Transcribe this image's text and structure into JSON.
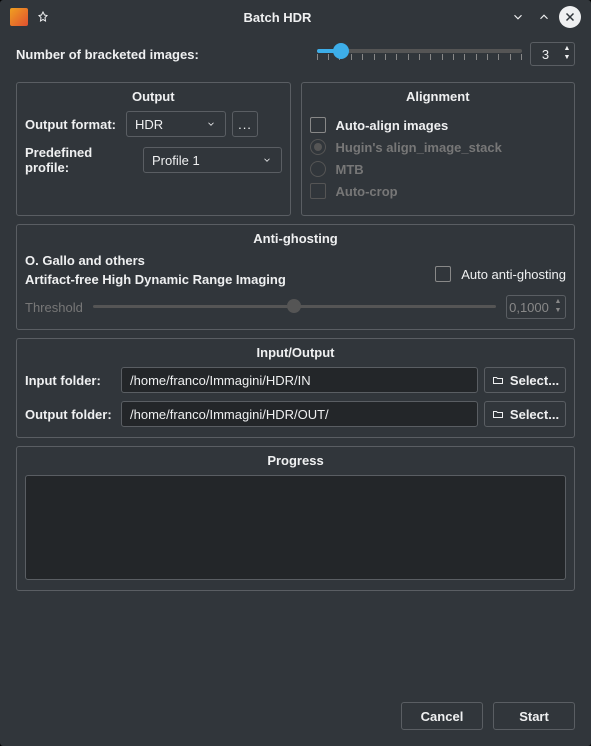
{
  "window": {
    "title": "Batch HDR"
  },
  "bracketed": {
    "label": "Number of bracketed images:",
    "value": "3"
  },
  "output": {
    "title": "Output",
    "formatLabel": "Output format:",
    "formatValue": "HDR",
    "moreBtn": "...",
    "profileLabel": "Predefined profile:",
    "profileValue": "Profile 1"
  },
  "alignment": {
    "title": "Alignment",
    "autoAlign": "Auto-align images",
    "hugin": "Hugin's align_image_stack",
    "mtb": "MTB",
    "autoCrop": "Auto-crop"
  },
  "antighost": {
    "title": "Anti-ghosting",
    "line1": "O. Gallo and others",
    "line2": "Artifact-free High Dynamic Range Imaging",
    "autoLabel": "Auto anti-ghosting",
    "thresholdLabel": "Threshold",
    "thresholdValue": "0,1000"
  },
  "io": {
    "title": "Input/Output",
    "inputLabel": "Input folder:",
    "inputValue": "/home/franco/Immagini/HDR/IN",
    "outputLabel": "Output folder:",
    "outputValue": "/home/franco/Immagini/HDR/OUT/",
    "selectLabel": "Select..."
  },
  "progress": {
    "title": "Progress"
  },
  "footer": {
    "cancel": "Cancel",
    "start": "Start"
  }
}
